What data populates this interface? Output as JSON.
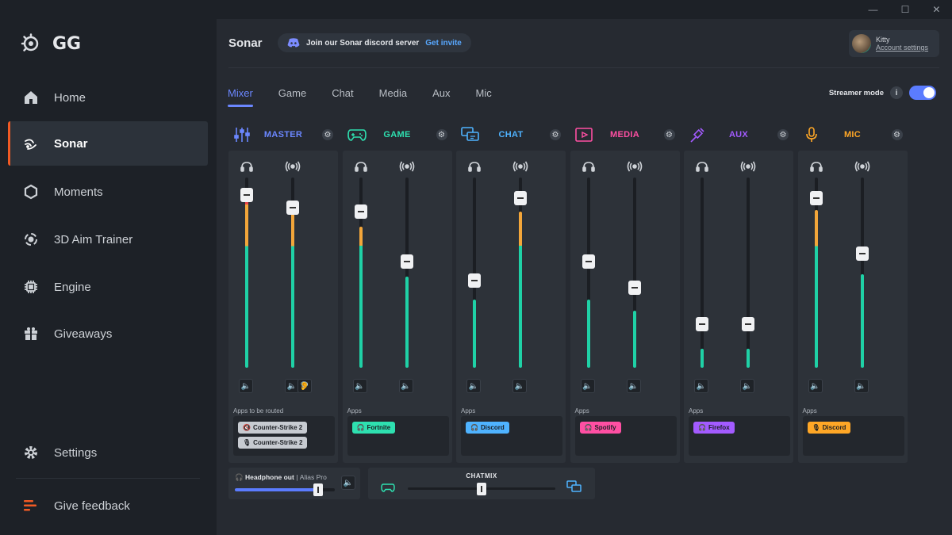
{
  "window": {
    "minimize": "—",
    "maximize": "☐",
    "close": "✕"
  },
  "brand": {
    "name": "GG"
  },
  "sidebar": {
    "items": [
      {
        "label": "Home",
        "icon": "home-icon"
      },
      {
        "label": "Sonar",
        "icon": "sonar-icon",
        "active": true
      },
      {
        "label": "Moments",
        "icon": "moments-icon"
      },
      {
        "label": "3D Aim Trainer",
        "icon": "aim-trainer-icon"
      },
      {
        "label": "Engine",
        "icon": "engine-icon"
      },
      {
        "label": "Giveaways",
        "icon": "gift-icon"
      }
    ],
    "settings": "Settings",
    "feedback": "Give feedback"
  },
  "header": {
    "title": "Sonar",
    "discord_text": "Join our Sonar discord server",
    "discord_link": "Get invite",
    "account_name": "Kitty",
    "account_link": "Account settings"
  },
  "tabs": [
    {
      "label": "Mixer",
      "active": true
    },
    {
      "label": "Game"
    },
    {
      "label": "Chat"
    },
    {
      "label": "Media"
    },
    {
      "label": "Aux"
    },
    {
      "label": "Mic"
    }
  ],
  "streamer_mode": {
    "label": "Streamer mode",
    "info": "i",
    "enabled": true
  },
  "channels": [
    {
      "name": "MASTER",
      "color": "#6b87ff",
      "icon": "mixer-sliders-icon",
      "apps_label": "Apps to be routed",
      "faders": [
        {
          "level": 0.91,
          "fill": 0.88,
          "meter": "multi"
        },
        {
          "level": 0.84,
          "fill": 0.83,
          "meter": "multi"
        }
      ],
      "apps": [
        {
          "label": "Counter-Strike 2",
          "color": "#c7cbd1",
          "icon": "muted-speaker-icon"
        },
        {
          "label": "Counter-Strike 2",
          "color": "#c7cbd1",
          "icon": "muted-mic-icon"
        }
      ]
    },
    {
      "name": "GAME",
      "color": "#2ee0b0",
      "icon": "gamepad-icon",
      "apps_label": "Apps",
      "faders": [
        {
          "level": 0.82,
          "fill": 0.74,
          "meter": "multi"
        },
        {
          "level": 0.56,
          "fill": 0.48,
          "meter": "teal"
        }
      ],
      "apps": [
        {
          "label": "Fortnite",
          "color": "#2ee0b0",
          "icon": "headphones-icon"
        }
      ]
    },
    {
      "name": "CHAT",
      "color": "#4fb3ff",
      "icon": "chat-bubbles-icon",
      "apps_label": "Apps",
      "faders": [
        {
          "level": 0.46,
          "fill": 0.36,
          "meter": "teal"
        },
        {
          "level": 0.89,
          "fill": 0.82,
          "meter": "multi"
        }
      ],
      "apps": [
        {
          "label": "Discord",
          "color": "#4fb3ff",
          "icon": "headphones-icon"
        }
      ]
    },
    {
      "name": "MEDIA",
      "color": "#ff4fa3",
      "icon": "play-window-icon",
      "apps_label": "Apps",
      "faders": [
        {
          "level": 0.56,
          "fill": 0.36,
          "meter": "teal"
        },
        {
          "level": 0.42,
          "fill": 0.3,
          "meter": "teal"
        }
      ],
      "apps": [
        {
          "label": "Spotify",
          "color": "#ff4fa3",
          "icon": "headphones-icon"
        }
      ]
    },
    {
      "name": "AUX",
      "color": "#a35bff",
      "icon": "cable-icon",
      "apps_label": "Apps",
      "faders": [
        {
          "level": 0.23,
          "fill": 0.1,
          "meter": "teal"
        },
        {
          "level": 0.23,
          "fill": 0.1,
          "meter": "teal"
        }
      ],
      "apps": [
        {
          "label": "Firefox",
          "color": "#a35bff",
          "icon": "headphones-icon"
        }
      ]
    },
    {
      "name": "MIC",
      "color": "#ffa726",
      "icon": "microphone-icon",
      "apps_label": "Apps",
      "faders": [
        {
          "level": 0.89,
          "fill": 0.83,
          "meter": "multi"
        },
        {
          "level": 0.6,
          "fill": 0.49,
          "meter": "teal"
        }
      ],
      "apps": [
        {
          "label": "Discord",
          "color": "#ffa726",
          "icon": "microphone-icon"
        }
      ]
    }
  ],
  "headphone": {
    "label": "Headphone out",
    "separator": "|",
    "device": "Alias Pro",
    "level": 0.83
  },
  "chatmix": {
    "label": "CHATMIX",
    "level": 0.5
  }
}
